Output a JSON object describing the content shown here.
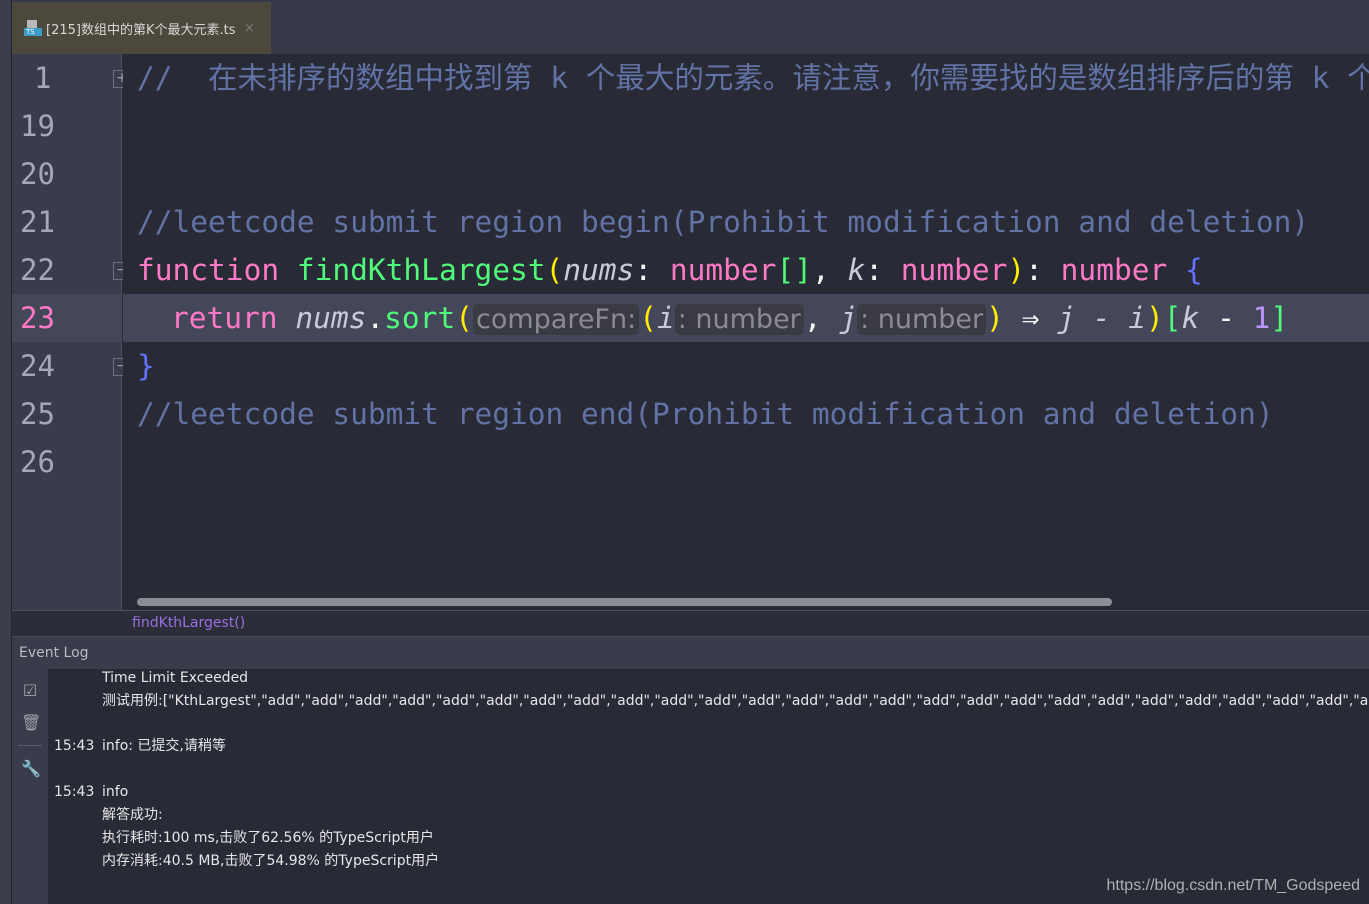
{
  "tab": {
    "title": "[215]数组中的第K个最大元素.ts",
    "close": "×",
    "icon": "typescript-file-icon"
  },
  "gutter": {
    "lines": [
      "1",
      "19",
      "20",
      "21",
      "22",
      "23",
      "24",
      "25",
      "26"
    ]
  },
  "code": {
    "l1": "//  在未排序的数组中找到第 k 个最大的元素。请注意，你需要找的是数组排序后的第 k 个最大的元素",
    "l21": "//leetcode submit region begin(Prohibit modification and deletion)",
    "l22": {
      "kw": "function",
      "fn": "findKthLargest",
      "p1": "(",
      "a1": "nums",
      "c1": ": ",
      "t1": "number",
      "br": "[]",
      "sep": ", ",
      "a2": "k",
      "c2": ": ",
      "t2": "number",
      "p2": ")",
      "c3": ": ",
      "t3": "number",
      "ob": " {"
    },
    "l23": {
      "kw": "return",
      "obj": "nums",
      "dot": ".",
      "fn": "sort",
      "p1": "(",
      "hint1": "compareFn:",
      "p2": "(",
      "a1": "i",
      "h2": ": number",
      "sep": ", ",
      "a2": "j",
      "h3": ": number",
      "p3": ")",
      "arrow": " ⇒ ",
      "expr": "j - i",
      "p4": ")",
      "b1": "[",
      "k": "k",
      "minus": " - ",
      "one": "1",
      "b2": "]"
    },
    "l24": "}",
    "l25": "//leetcode submit region end(Prohibit modification and deletion)"
  },
  "breadcrumb": "findKthLargest()",
  "event_log": {
    "title": "Event Log",
    "entries": [
      {
        "time": "",
        "lines": [
          "Time Limit Exceeded",
          "测试用例:[\"KthLargest\",\"add\",\"add\",\"add\",\"add\",\"add\",\"add\",\"add\",\"add\",\"add\",\"add\",\"add\",\"add\",\"add\",\"add\",\"add\",\"add\",\"add\",\"add\",\"add\",\"add\",\"add\",\"add\",\"add\",\"add\",\"add\",\"add\",\"add\",\"add\",\"add\",\"add\",\"add\""
        ]
      },
      {
        "time": "15:43",
        "lines": [
          "info: 已提交,请稍等"
        ]
      },
      {
        "time": "15:43",
        "lines": [
          "info",
          "解答成功:",
          "执行耗时:100 ms,击败了62.56% 的TypeScript用户",
          "内存消耗:40.5 MB,击败了54.98% 的TypeScript用户"
        ]
      }
    ]
  },
  "watermark": "https://blog.csdn.net/TM_Godspeed"
}
